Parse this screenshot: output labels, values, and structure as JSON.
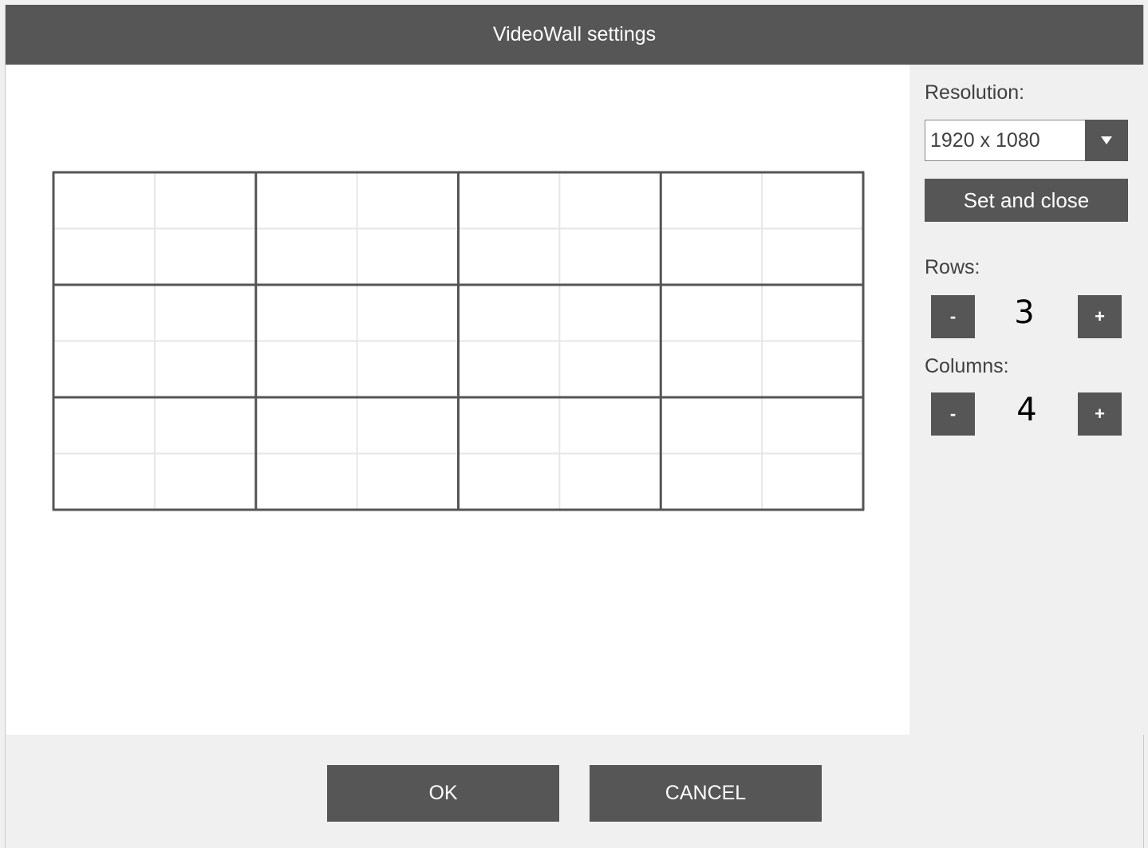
{
  "dialog": {
    "title": "VideoWall settings"
  },
  "wall": {
    "rows": 3,
    "columns": 4
  },
  "sidebar": {
    "resolution_label": "Resolution:",
    "resolution_value": "1920 x 1080",
    "set_and_close_label": "Set and close",
    "rows_label": "Rows:",
    "rows_value": "3",
    "columns_label": "Columns:",
    "columns_value": "4",
    "minus_label": "-",
    "plus_label": "+"
  },
  "footer": {
    "ok_label": "OK",
    "cancel_label": "CANCEL"
  },
  "colors": {
    "titlebar": "#565656",
    "button": "#565656",
    "panel": "#f0f0f0",
    "grid_major": "#555555",
    "grid_minor": "#e6e6e6"
  }
}
